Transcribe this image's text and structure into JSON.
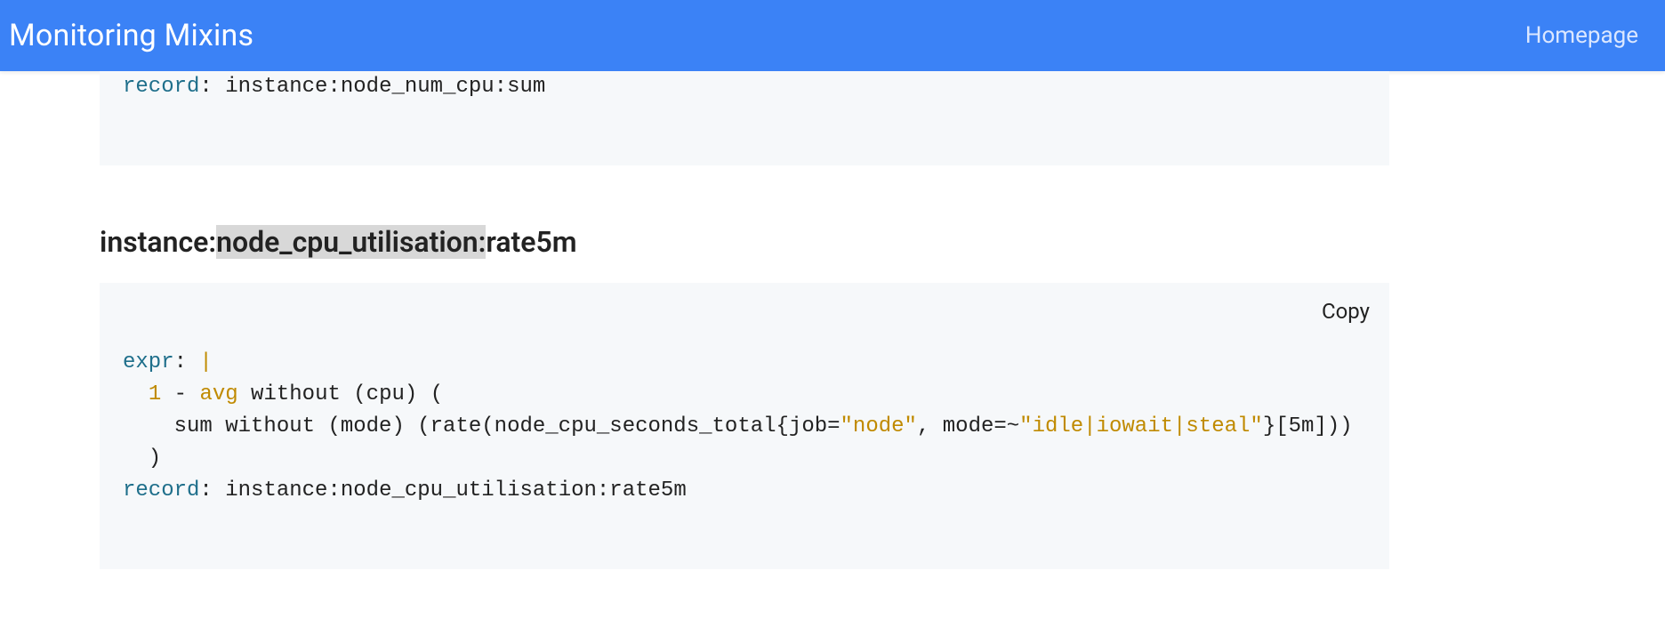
{
  "header": {
    "title": "Monitoring Mixins",
    "homepage_label": "Homepage"
  },
  "block1": {
    "record_key": "record",
    "record_value": "instance:node_num_cpu:sum"
  },
  "section": {
    "heading_pre": "instance:",
    "heading_hl": "node_cpu_utilisation:",
    "heading_post": "rate5m"
  },
  "block2": {
    "copy_label": "Copy",
    "expr_key": "expr",
    "pipe": "|",
    "l1_num": "1",
    "l1_dash": " - ",
    "l1_func": "avg",
    "l1_rest": " without (cpu) (",
    "l2_indent": "    ",
    "l2_pre": "sum without (mode) (rate(node_cpu_seconds_total{job=",
    "l2_str1": "\"node\"",
    "l2_mid": ", mode=~",
    "l2_str2": "\"idle|iowait|steal\"",
    "l2_post": "}[5m]))",
    "l3": "  )",
    "record_key": "record",
    "record_value": "instance:node_cpu_utilisation:rate5m"
  }
}
